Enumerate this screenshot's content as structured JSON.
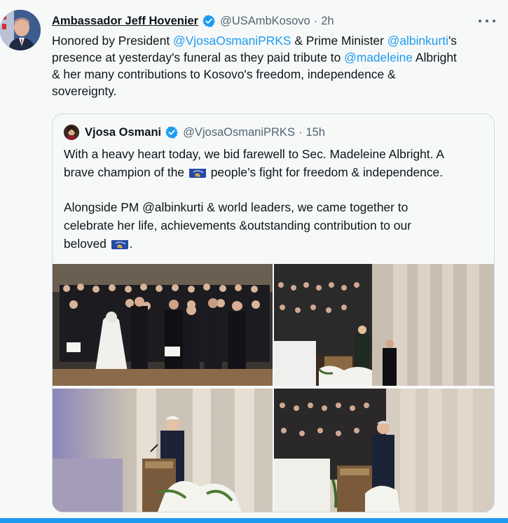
{
  "tweet": {
    "author_name": "Ambassador Jeff Hovenier",
    "author_handle": "@USAmbKosovo",
    "separator": "·",
    "time": "2h",
    "text_lines": [
      [
        "Honored by President ",
        "@VjosaOsmaniPRKS",
        " & Prime Minister ",
        "@albinkurti",
        "'s"
      ],
      [
        "presence at yesterday's funeral as they paid tribute to ",
        "@madeleine",
        " Albright"
      ],
      [
        "& her many contributions to Kosovo's freedom, independence &"
      ],
      [
        "sovereignty."
      ]
    ],
    "more_icon": "more-horizontal-icon",
    "verified_icon": "verified-badge-icon"
  },
  "quote": {
    "author_name": "Vjosa Osmani",
    "author_handle": "@VjosaOsmaniPRKS",
    "separator": "·",
    "time": "15h",
    "line1": "With a heavy heart today, we bid farewell to Sec. Madeleine Albright. A",
    "line2_a": "brave champion of the ",
    "line2_b": " people’s fight for freedom & independence.",
    "line3": "Alongside PM @albinkurti & world leaders, we came together to",
    "line4": "celebrate her life, achievements &outstanding contribution to our",
    "line5_a": "beloved ",
    "line5_b": ".",
    "flag_icon": "kosovo-flag-emoji",
    "photos": [
      "funeral-crowd-photo",
      "cathedral-podium-photo",
      "president-speaking-photo",
      "speaker-at-podium-photo"
    ]
  },
  "colors": {
    "link": "#1d9bf0",
    "text": "#0f1419",
    "secondary": "#536471",
    "background": "#f7f9f9",
    "border": "#cfd9de",
    "flag_blue": "#244aa5",
    "flag_gold": "#d0a650"
  }
}
